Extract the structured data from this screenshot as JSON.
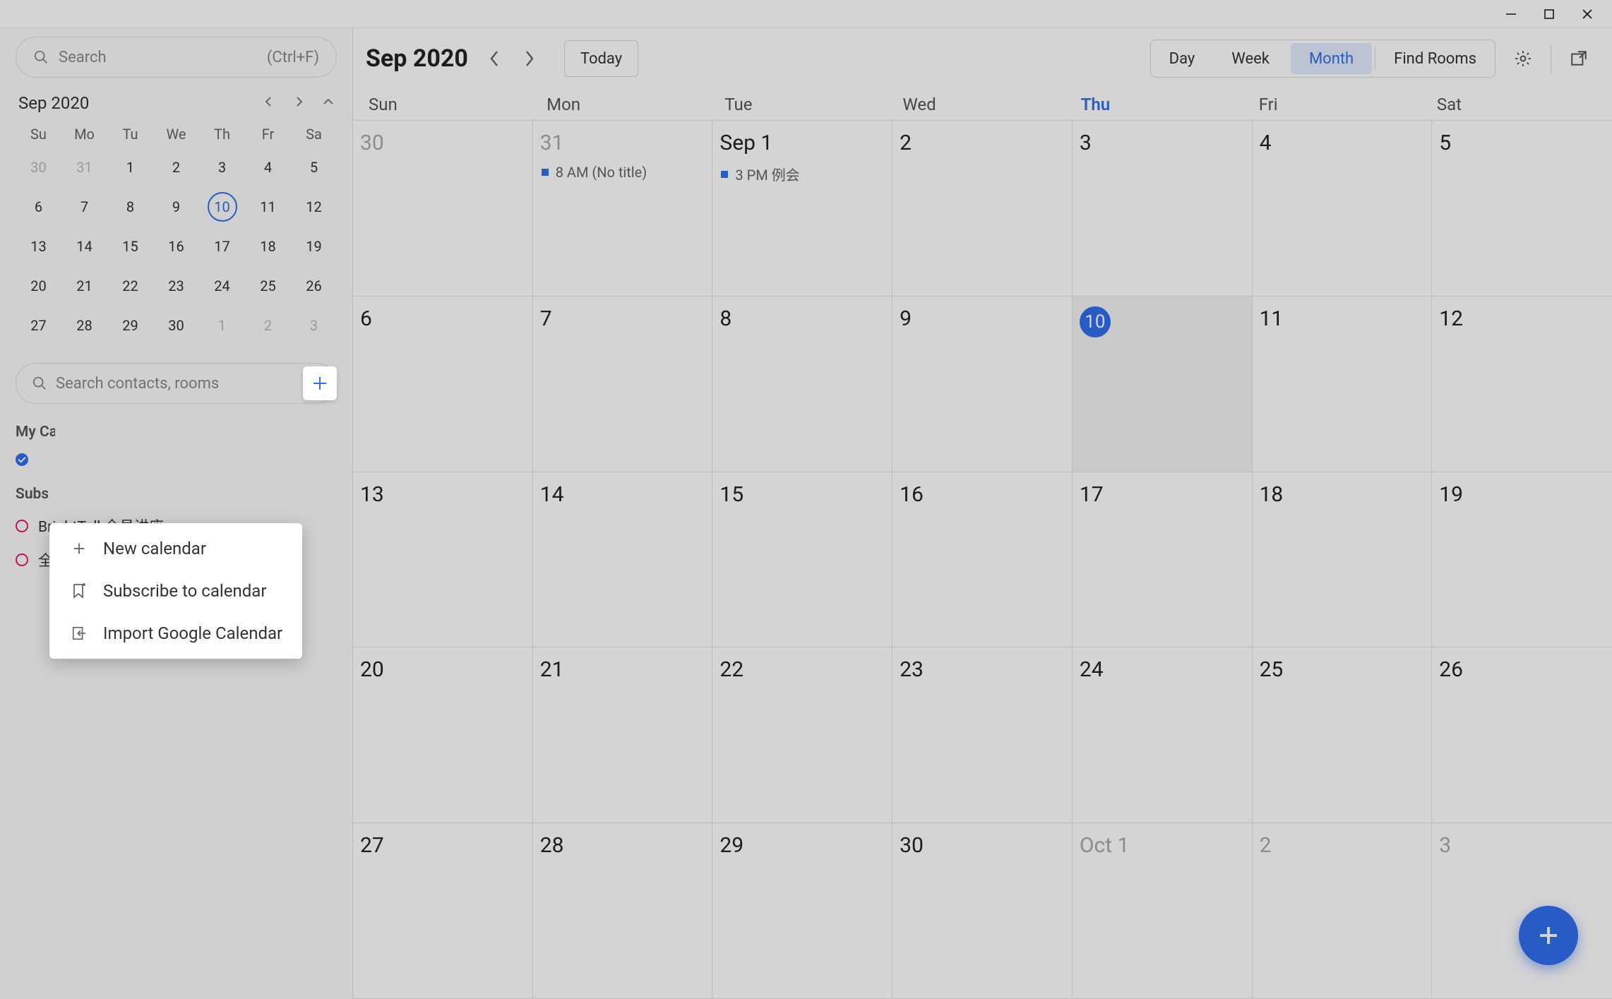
{
  "titlebar": {},
  "sidebar": {
    "search": {
      "placeholder": "Search",
      "shortcut": "(Ctrl+F)"
    },
    "miniMonth": {
      "title": "Sep 2020",
      "weekdays": [
        "Su",
        "Mo",
        "Tu",
        "We",
        "Th",
        "Fr",
        "Sa"
      ],
      "rows": [
        [
          {
            "n": "30",
            "muted": true
          },
          {
            "n": "31",
            "muted": true
          },
          {
            "n": "1"
          },
          {
            "n": "2"
          },
          {
            "n": "3"
          },
          {
            "n": "4"
          },
          {
            "n": "5"
          }
        ],
        [
          {
            "n": "6"
          },
          {
            "n": "7"
          },
          {
            "n": "8"
          },
          {
            "n": "9"
          },
          {
            "n": "10",
            "today": true
          },
          {
            "n": "11"
          },
          {
            "n": "12"
          }
        ],
        [
          {
            "n": "13"
          },
          {
            "n": "14"
          },
          {
            "n": "15"
          },
          {
            "n": "16"
          },
          {
            "n": "17"
          },
          {
            "n": "18"
          },
          {
            "n": "19"
          }
        ],
        [
          {
            "n": "20"
          },
          {
            "n": "21"
          },
          {
            "n": "22"
          },
          {
            "n": "23"
          },
          {
            "n": "24"
          },
          {
            "n": "25"
          },
          {
            "n": "26"
          }
        ],
        [
          {
            "n": "27"
          },
          {
            "n": "28"
          },
          {
            "n": "29"
          },
          {
            "n": "30"
          },
          {
            "n": "1",
            "muted": true
          },
          {
            "n": "2",
            "muted": true
          },
          {
            "n": "3",
            "muted": true
          }
        ]
      ]
    },
    "contactsSearch": {
      "placeholder": "Search contacts, rooms"
    },
    "sections": {
      "myCalendarsTitle": "My Calendars",
      "myCalendars": [
        {
          "label": ""
        }
      ],
      "subscribedTitle": "Subscribed",
      "subscribed": [
        {
          "label": "BrightTalk全员讲座"
        },
        {
          "label": "全员健身"
        }
      ]
    },
    "popup": {
      "items": [
        {
          "label": "New calendar"
        },
        {
          "label": "Subscribe to calendar"
        },
        {
          "label": "Import Google Calendar"
        }
      ]
    }
  },
  "header": {
    "title": "Sep 2020",
    "todayLabel": "Today",
    "views": {
      "day": "Day",
      "week": "Week",
      "month": "Month",
      "findRooms": "Find Rooms"
    }
  },
  "dow": [
    "Sun",
    "Mon",
    "Tue",
    "Wed",
    "Thu",
    "Fri",
    "Sat"
  ],
  "todayIndex": 4,
  "grid": {
    "weeks": [
      [
        {
          "label": "30",
          "muted": true
        },
        {
          "label": "31",
          "muted": true,
          "events": [
            {
              "text": "8 AM (No title)"
            }
          ]
        },
        {
          "label": "Sep 1",
          "events": [
            {
              "text": "3 PM 例会"
            }
          ]
        },
        {
          "label": "2"
        },
        {
          "label": "3"
        },
        {
          "label": "4"
        },
        {
          "label": "5"
        }
      ],
      [
        {
          "label": "6"
        },
        {
          "label": "7"
        },
        {
          "label": "8"
        },
        {
          "label": "9"
        },
        {
          "label": "10",
          "today": true
        },
        {
          "label": "11"
        },
        {
          "label": "12"
        }
      ],
      [
        {
          "label": "13"
        },
        {
          "label": "14"
        },
        {
          "label": "15"
        },
        {
          "label": "16"
        },
        {
          "label": "17"
        },
        {
          "label": "18"
        },
        {
          "label": "19"
        }
      ],
      [
        {
          "label": "20"
        },
        {
          "label": "21"
        },
        {
          "label": "22"
        },
        {
          "label": "23"
        },
        {
          "label": "24"
        },
        {
          "label": "25"
        },
        {
          "label": "26"
        }
      ],
      [
        {
          "label": "27"
        },
        {
          "label": "28"
        },
        {
          "label": "29"
        },
        {
          "label": "30"
        },
        {
          "label": "Oct 1",
          "muted": true
        },
        {
          "label": "2",
          "muted": true
        },
        {
          "label": "3",
          "muted": true
        }
      ]
    ]
  }
}
